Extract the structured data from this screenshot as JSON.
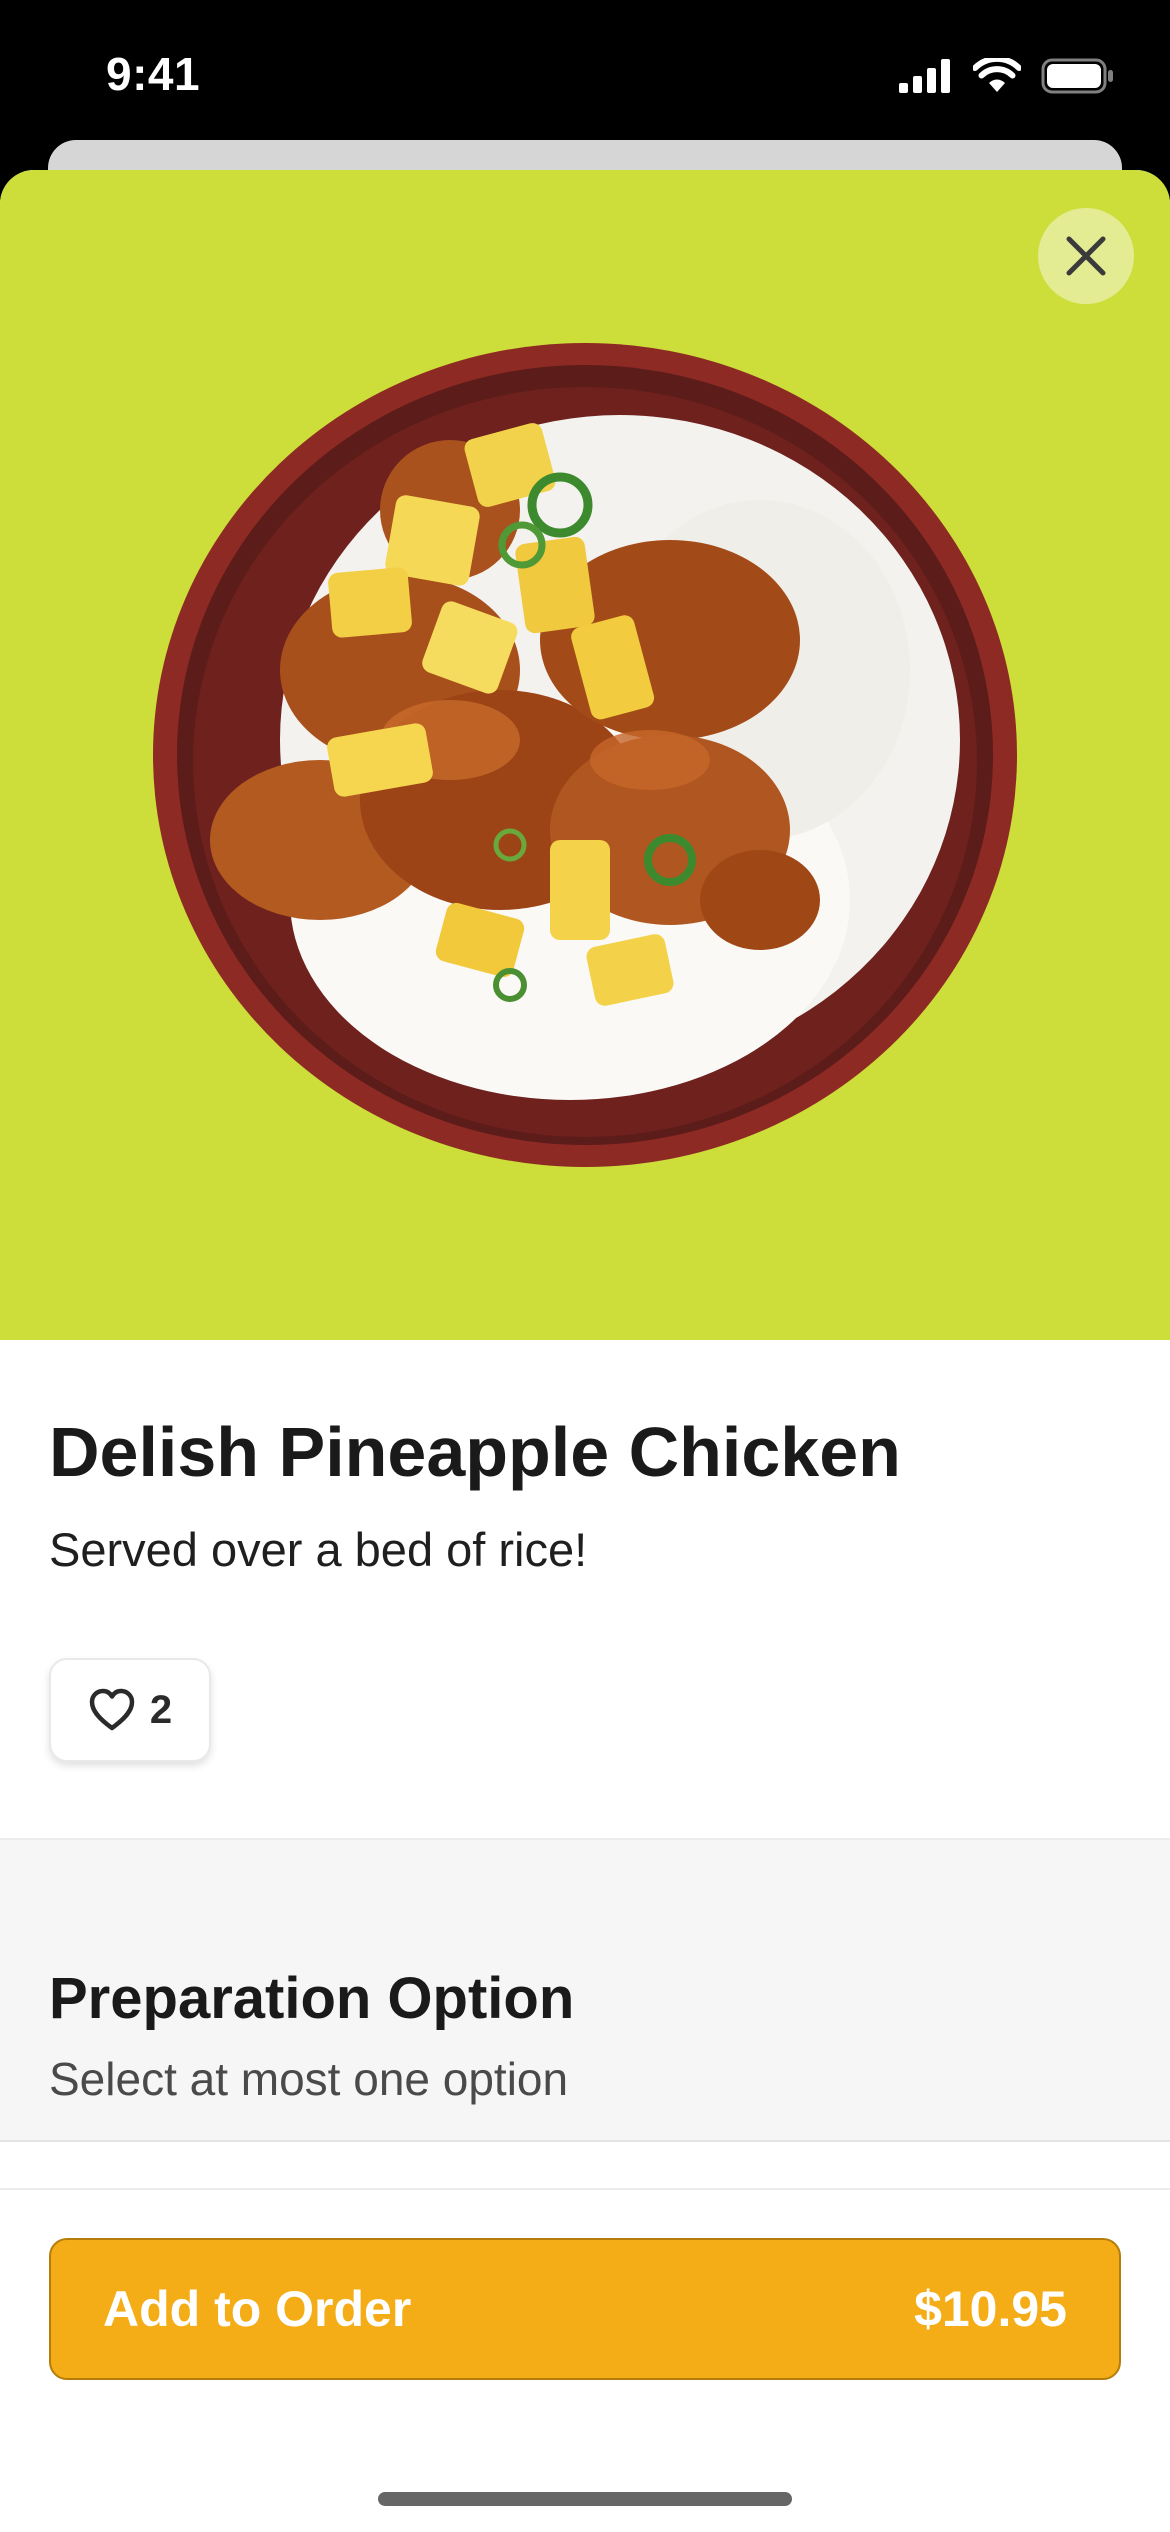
{
  "status_bar": {
    "time": "9:41",
    "icons": [
      "cellular-signal-icon",
      "wifi-icon",
      "battery-icon"
    ]
  },
  "hero": {
    "background_color": "#cddd3a",
    "image_subject": "rice bowl with pineapple chicken",
    "close_icon": "close-icon"
  },
  "item": {
    "title": "Delish Pineapple Chicken",
    "description": "Served over a bed of rice!",
    "likes": "2",
    "like_icon": "heart-outline-icon"
  },
  "preparation": {
    "title": "Preparation Option",
    "subtitle": "Select at most one option"
  },
  "order": {
    "button_label": "Add to Order",
    "price": "$10.95",
    "accent_color": "#f5ad17"
  }
}
